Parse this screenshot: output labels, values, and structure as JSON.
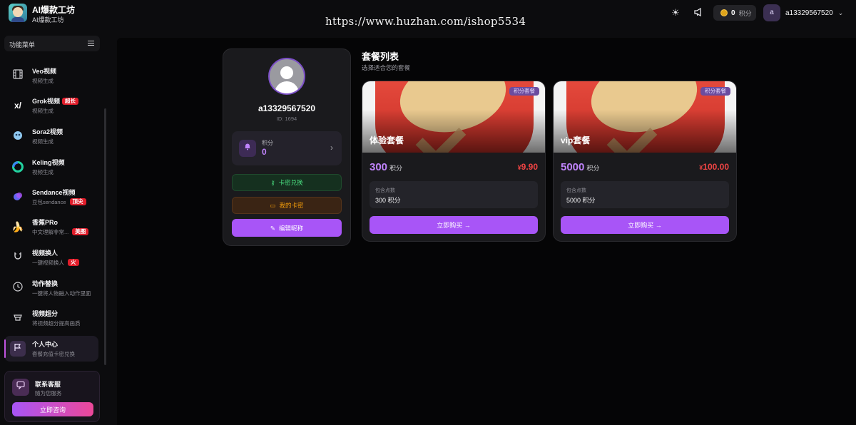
{
  "header": {
    "app_title": "AI爆款工坊",
    "app_subtitle": "AI爆款工坊",
    "watermark": "https://www.huzhan.com/ishop5534",
    "points_value": "0",
    "points_unit": "积分",
    "user_initial": "a",
    "username": "a13329567520"
  },
  "sidebar": {
    "menu_label": "功能菜单",
    "items": [
      {
        "title": "Veo视频",
        "sub": "视频生成",
        "badge": "",
        "icon": "film-grid-icon"
      },
      {
        "title": "Grok视频",
        "sub": "视频生成",
        "badge": "超长",
        "icon": "xai-logo-icon"
      },
      {
        "title": "Sora2视频",
        "sub": "视频生成",
        "badge": "",
        "icon": "sora-cloud-icon"
      },
      {
        "title": "Keling视频",
        "sub": "视频生成",
        "badge": "",
        "icon": "kling-swirl-icon"
      },
      {
        "title": "Sendance视频",
        "sub": "豆包sendance",
        "badge": "顶尖",
        "icon": "bytedance-icon"
      },
      {
        "title": "香蕉PRo",
        "sub": "中文理解非常...",
        "badge": "美图",
        "icon": "banana-icon"
      },
      {
        "title": "视频换人",
        "sub": "一键视频换人",
        "badge": "火",
        "icon": "magnet-icon"
      },
      {
        "title": "动作替换",
        "sub": "一键将人物融入动作里面",
        "badge": "",
        "icon": "clock-icon"
      },
      {
        "title": "视频超分",
        "sub": "将视频超分提高画质",
        "badge": "",
        "icon": "upscale-icon"
      },
      {
        "title": "个人中心",
        "sub": "套餐充值卡密兑换",
        "badge": "",
        "icon": "flag-icon"
      }
    ],
    "contact": {
      "title": "联系客服",
      "sub": "随为您服务",
      "button": "立即咨询"
    }
  },
  "profile": {
    "username": "a13329567520",
    "id_text": "ID: 1694",
    "points_label": "积分",
    "points_value": "0",
    "redeem_label": "卡密兑换",
    "mycard_label": "我的卡密",
    "edit_label": "编辑昵称"
  },
  "packages": {
    "title": "套餐列表",
    "subtitle": "选择适合您的套餐",
    "items": [
      {
        "tag": "积分套餐",
        "name": "体验套餐",
        "points": "300",
        "points_unit": "积分",
        "price_symbol": "¥",
        "price": "9.90",
        "includes_label": "包含点数",
        "includes_value": "300 积分",
        "buy_label": "立即购买"
      },
      {
        "tag": "积分套餐",
        "name": "vip套餐",
        "points": "5000",
        "points_unit": "积分",
        "price_symbol": "¥",
        "price": "100.00",
        "includes_label": "包含点数",
        "includes_value": "5000 积分",
        "buy_label": "立即购买"
      }
    ]
  },
  "colors": {
    "accent": "#a855f7",
    "price_red": "#f04444",
    "badge_red": "#e11d2a",
    "redeem_green": "#4ade80",
    "mycard_amber": "#f59e0b"
  }
}
